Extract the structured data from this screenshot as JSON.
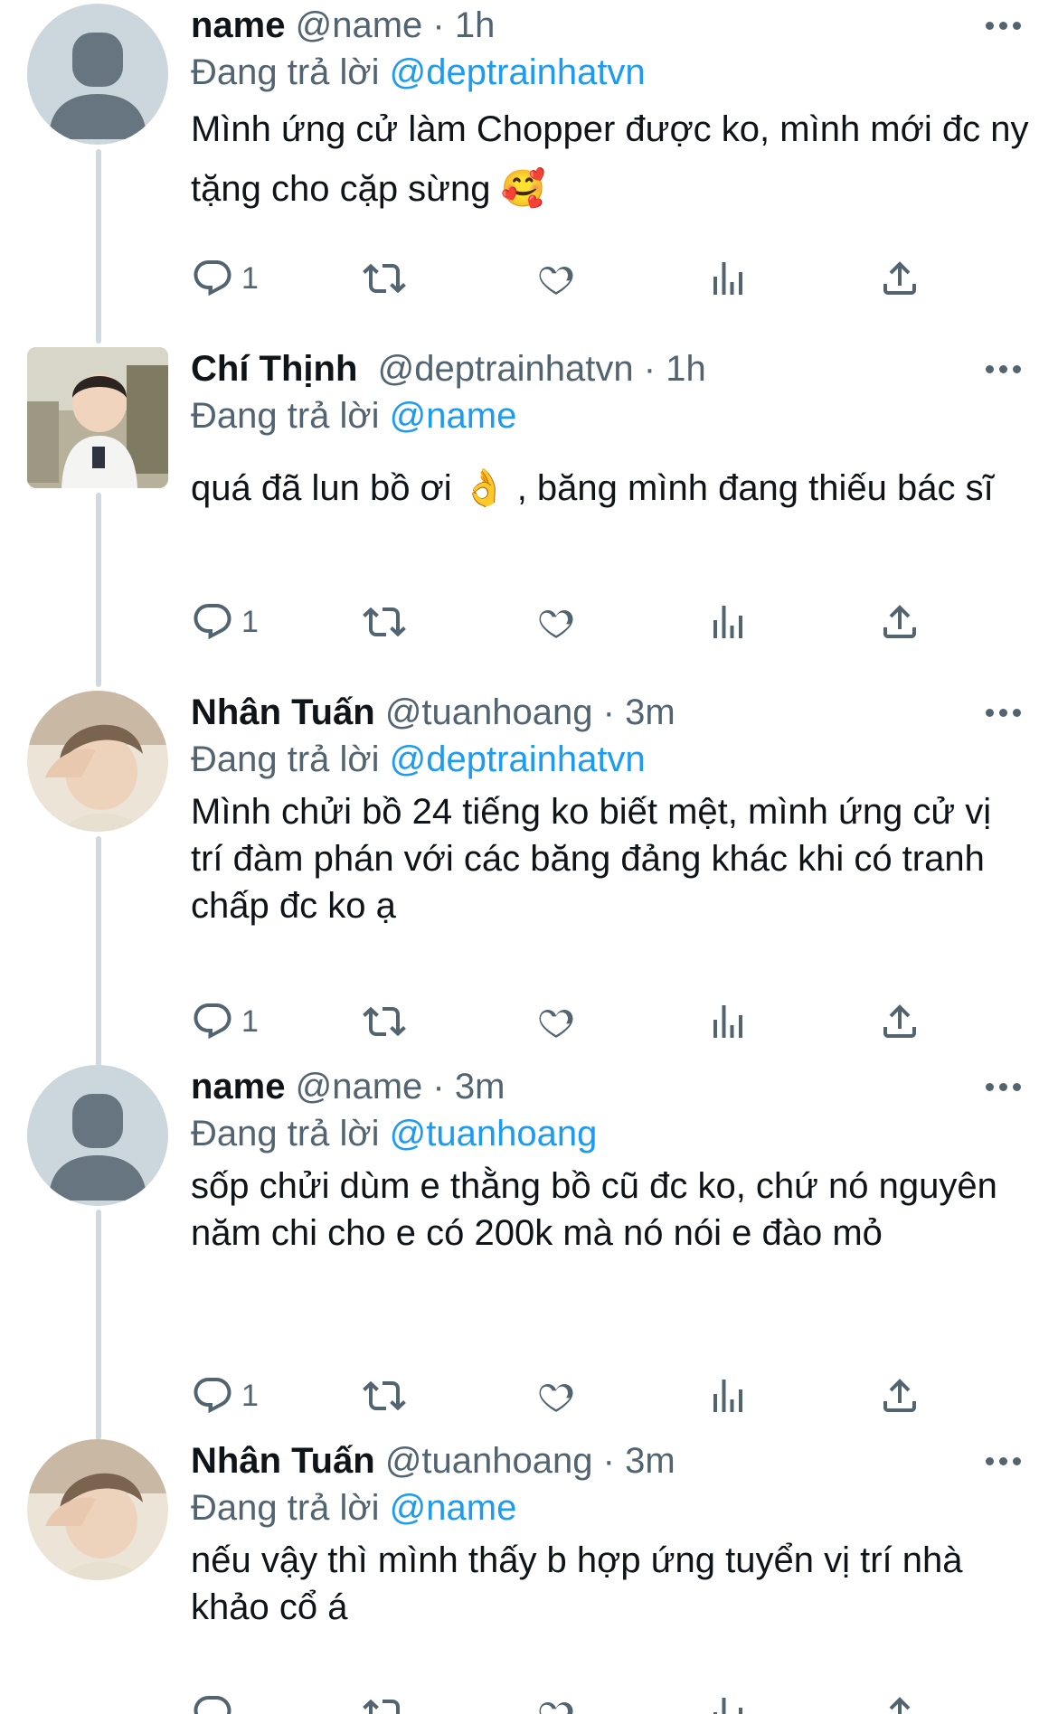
{
  "tweets": [
    {
      "name": "name",
      "handle": "@name",
      "time": "1h",
      "reply_prefix": "Đang trả lời",
      "reply_to": "@deptrainhatvn",
      "text": "Mình ứng cử làm Chopper được ko, mình mới đc ny tặng cho cặp sừng 🥰",
      "reply_count": "1",
      "avatar": "default-avatar"
    },
    {
      "name": "Chí Thịnh",
      "handle": "@deptrainhatvn",
      "time": "1h",
      "reply_prefix": "Đang trả lời",
      "reply_to": "@name",
      "text": "quá đã lun bồ ơi 👌 , băng mình đang thiếu bác sĩ",
      "reply_count": "1",
      "avatar": "child-photo-avatar"
    },
    {
      "name": "Nhân Tuấn",
      "handle": "@tuanhoang",
      "time": "3m",
      "reply_prefix": "Đang trả lời",
      "reply_to": "@deptrainhatvn",
      "text": "Mình chửi bồ 24 tiếng ko biết mệt, mình ứng cử vị trí đàm phán với các băng đảng khác khi có tranh chấp đc ko ạ",
      "reply_count": "1",
      "avatar": "man-photo-avatar"
    },
    {
      "name": "name",
      "handle": "@name",
      "time": "3m",
      "reply_prefix": "Đang trả lời",
      "reply_to": "@tuanhoang",
      "text": "sốp chửi dùm e thằng bồ cũ đc ko, chứ nó nguyên năm chi cho e có 200k mà nó nói e đào mỏ",
      "reply_count": "1",
      "avatar": "default-avatar"
    },
    {
      "name": "Nhân Tuấn",
      "handle": "@tuanhoang",
      "time": "3m",
      "reply_prefix": "Đang trả lời",
      "reply_to": "@name",
      "text": "nếu vậy thì mình thấy b hợp ứng tuyển vị trí nhà khảo cổ á",
      "reply_count": "",
      "avatar": "man-photo-avatar"
    }
  ],
  "separator": "·",
  "icons": {
    "reply": "reply-icon",
    "retweet": "retweet-icon",
    "like": "heart-icon",
    "analytics": "analytics-icon",
    "share": "share-icon",
    "more": "more-icon"
  },
  "colors": {
    "accent": "#1d9bf0",
    "secondary": "#536471",
    "thread_line": "#cfd9de"
  }
}
